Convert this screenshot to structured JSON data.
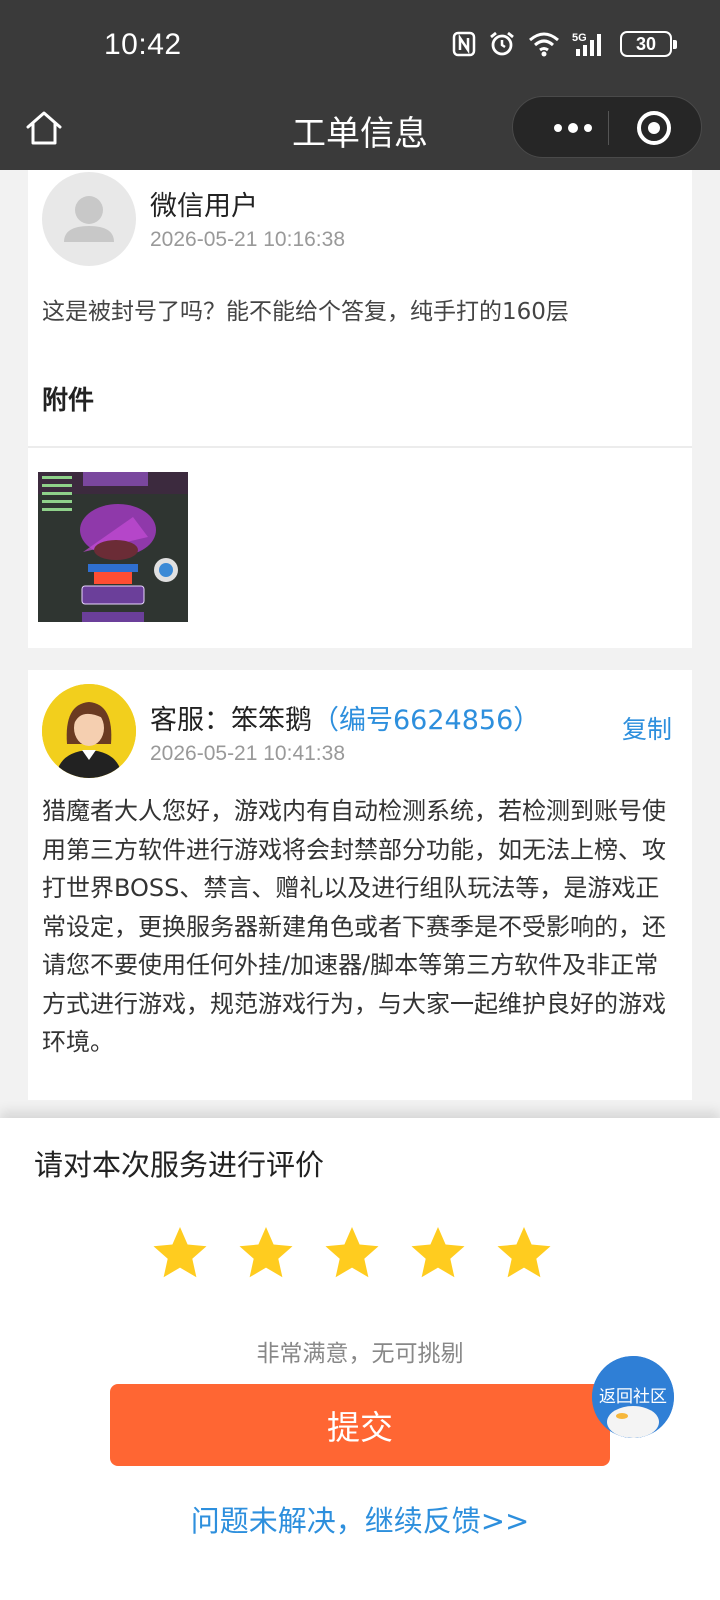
{
  "status_bar": {
    "time": "10:42",
    "battery": "30",
    "network": "5G",
    "icons": [
      "nfc-icon",
      "alarm-icon",
      "wifi-icon",
      "signal-icon",
      "battery-icon"
    ]
  },
  "nav": {
    "title": "工单信息",
    "home_icon": "home-icon",
    "more_icon": "more-icon",
    "close_icon": "target-icon"
  },
  "user_message": {
    "name": "微信用户",
    "time": "2026-05-21 10:16:38",
    "content": "这是被封号了吗？能不能给个答复，纯手打的160层",
    "attachment_title": "附件"
  },
  "agent_reply": {
    "name_prefix": "客服：笨笨鹅",
    "code": "（编号6624856）",
    "copy_label": "复制",
    "time": "2026-05-21 10:41:38",
    "content": "猎魔者大人您好，游戏内有自动检测系统，若检测到账号使用第三方软件进行游戏将会封禁部分功能，如无法上榜、攻打世界BOSS、禁言、赠礼以及进行组队玩法等，是游戏正常设定，更换服务器新建角色或者下赛季是不受影响的，还请您不要使用任何外挂/加速器/脚本等第三方软件及非正常方式进行游戏，规范游戏行为，与大家一起维护良好的游戏环境。"
  },
  "rating": {
    "title": "请对本次服务进行评价",
    "stars_selected": 5,
    "stars_total": 5,
    "star_color": "#ffcc1f",
    "result_text": "非常满意，无可挑剔",
    "submit_label": "提交",
    "feedback_link": "问题未解决，继续反馈>>"
  },
  "float_button": {
    "label": "返回社区"
  },
  "colors": {
    "accent_blue": "#2d8fdd",
    "submit_orange": "#ff6633",
    "header_dark": "#3a3a3a"
  }
}
